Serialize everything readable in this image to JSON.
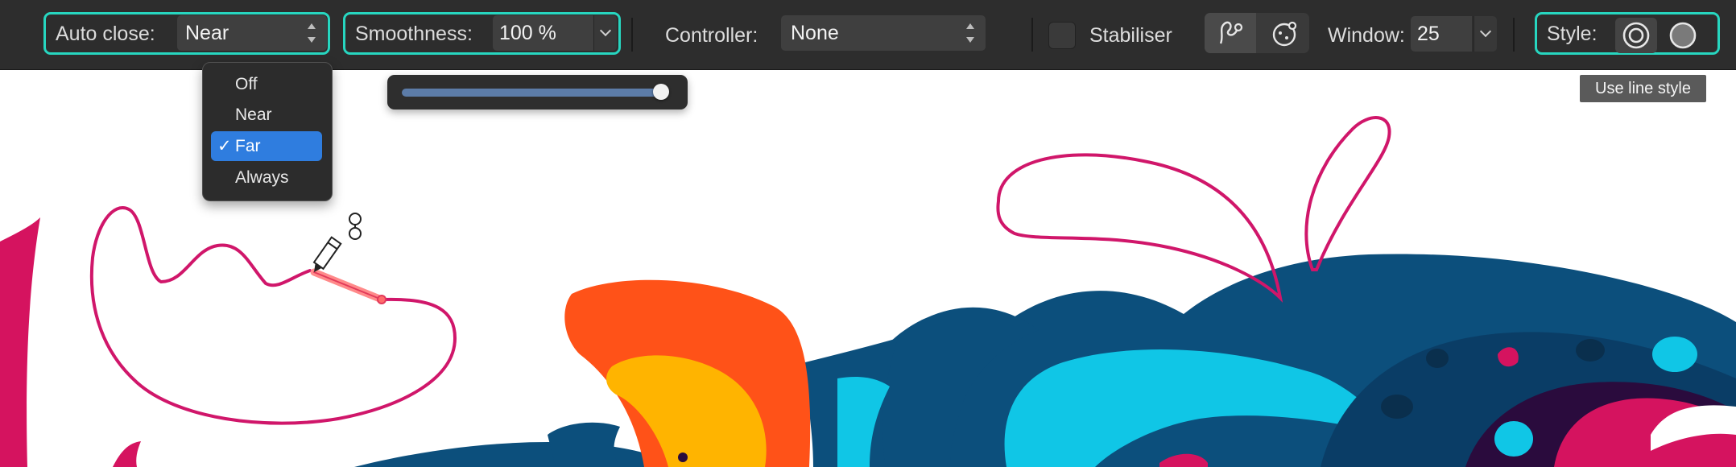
{
  "toolbar": {
    "auto_close": {
      "label": "Auto close:",
      "value": "Near"
    },
    "smoothness": {
      "label": "Smoothness:",
      "value": "100 %"
    },
    "controller": {
      "label": "Controller:",
      "value": "None"
    },
    "stabiliser": {
      "label": "Stabiliser",
      "checked": false
    },
    "stabiliser_modes": [
      {
        "icon": "rope-mode-icon",
        "active": true
      },
      {
        "icon": "window-mode-icon",
        "active": false
      }
    ],
    "window": {
      "label": "Window:",
      "value": "25"
    },
    "style": {
      "label": "Style:",
      "options": [
        {
          "icon": "line-style-icon",
          "selected": true
        },
        {
          "icon": "fill-style-icon",
          "selected": false
        }
      ]
    }
  },
  "auto_close_menu": {
    "items": [
      {
        "label": "Off",
        "selected": false
      },
      {
        "label": "Near",
        "selected": false
      },
      {
        "label": "Far",
        "selected": true
      },
      {
        "label": "Always",
        "selected": false
      }
    ],
    "check_glyph": "✓"
  },
  "smoothness_slider": {
    "value_fraction": 1.0
  },
  "tooltip": {
    "text": "Use line style"
  },
  "colors": {
    "focus_outline": "#27d6c0",
    "toolbar_bg": "#2d2d2d",
    "stroke_magenta": "#d0166a",
    "art_navy": "#0c4f7c",
    "art_cyan": "#10c6e6",
    "art_orange": "#ff5218",
    "art_yellow": "#ffb400",
    "art_pink": "#d5135f",
    "menu_highlight": "#2f7ddf"
  }
}
